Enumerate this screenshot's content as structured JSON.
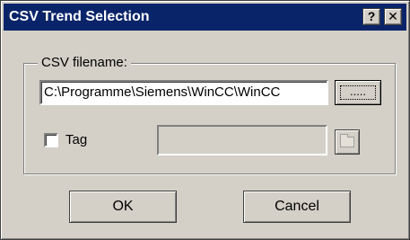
{
  "window": {
    "title": "CSV Trend Selection",
    "help_label": "?",
    "close_label": "✕"
  },
  "csv_group": {
    "legend": "CSV filename:",
    "filename_value": "C:\\Programme\\Siemens\\WinCC\\WinCC",
    "browse_label": "....."
  },
  "tag": {
    "checkbox_checked": false,
    "label": "Tag",
    "value": "",
    "browse_icon": "folder-icon"
  },
  "buttons": {
    "ok_label": "OK",
    "cancel_label": "Cancel"
  },
  "colors": {
    "titlebar": "#0a246a",
    "face": "#d4d0c8"
  }
}
